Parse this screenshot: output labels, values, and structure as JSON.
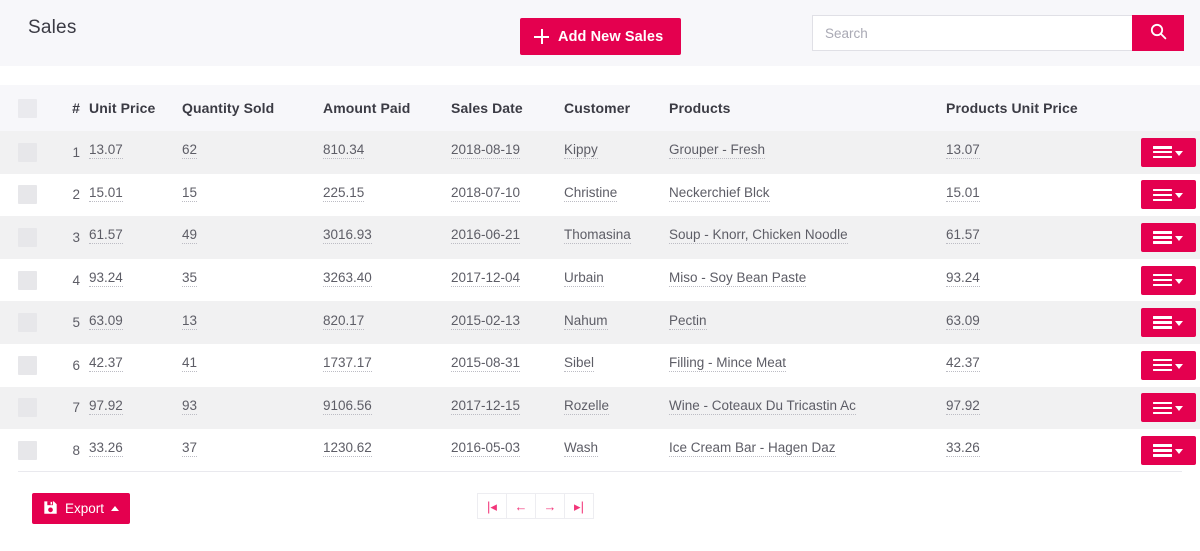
{
  "header": {
    "title": "Sales",
    "add_button_label": "Add New Sales",
    "add_button_icon": "plus-icon",
    "search_placeholder": "Search",
    "search_value": "",
    "search_icon": "search-icon"
  },
  "colors": {
    "accent": "#e4004f",
    "pager_accent": "#f2367a",
    "topbar_bg": "#f7f7fa",
    "row_odd_bg": "#f1f1f2",
    "row_even_bg": "#ffffff",
    "header_text": "#3b3b44",
    "cell_text": "#5d5d66"
  },
  "table": {
    "select_all_checkbox": "unchecked",
    "columns": [
      {
        "key": "select",
        "label": "",
        "name": "select-all-column"
      },
      {
        "key": "num",
        "label": "#",
        "name": "row-number-column"
      },
      {
        "key": "unit_price",
        "label": "Unit Price",
        "name": "unit-price-column"
      },
      {
        "key": "quantity",
        "label": "Quantity Sold",
        "name": "quantity-sold-column"
      },
      {
        "key": "amount",
        "label": "Amount Paid",
        "name": "amount-paid-column"
      },
      {
        "key": "date",
        "label": "Sales Date",
        "name": "sales-date-column"
      },
      {
        "key": "customer",
        "label": "Customer",
        "name": "customer-column"
      },
      {
        "key": "products",
        "label": "Products",
        "name": "products-column"
      },
      {
        "key": "prod_unit",
        "label": "Products Unit Price",
        "name": "products-unit-price-column"
      },
      {
        "key": "actions",
        "label": "",
        "name": "actions-column"
      }
    ],
    "rows": [
      {
        "num": "1",
        "unit_price": "13.07",
        "quantity": "62",
        "amount": "810.34",
        "date": "2018-08-19",
        "customer": "Kippy",
        "products": "Grouper - Fresh",
        "prod_unit": "13.07"
      },
      {
        "num": "2",
        "unit_price": "15.01",
        "quantity": "15",
        "amount": "225.15",
        "date": "2018-07-10",
        "customer": "Christine",
        "products": "Neckerchief Blck",
        "prod_unit": "15.01"
      },
      {
        "num": "3",
        "unit_price": "61.57",
        "quantity": "49",
        "amount": "3016.93",
        "date": "2016-06-21",
        "customer": "Thomasina",
        "products": "Soup - Knorr, Chicken Noodle",
        "prod_unit": "61.57"
      },
      {
        "num": "4",
        "unit_price": "93.24",
        "quantity": "35",
        "amount": "3263.40",
        "date": "2017-12-04",
        "customer": "Urbain",
        "products": "Miso - Soy Bean Paste",
        "prod_unit": "93.24"
      },
      {
        "num": "5",
        "unit_price": "63.09",
        "quantity": "13",
        "amount": "820.17",
        "date": "2015-02-13",
        "customer": "Nahum",
        "products": "Pectin",
        "prod_unit": "63.09"
      },
      {
        "num": "6",
        "unit_price": "42.37",
        "quantity": "41",
        "amount": "1737.17",
        "date": "2015-08-31",
        "customer": "Sibel",
        "products": "Filling - Mince Meat",
        "prod_unit": "42.37"
      },
      {
        "num": "7",
        "unit_price": "97.92",
        "quantity": "93",
        "amount": "9106.56",
        "date": "2017-12-15",
        "customer": "Rozelle",
        "products": "Wine - Coteaux Du Tricastin Ac",
        "prod_unit": "97.92"
      },
      {
        "num": "8",
        "unit_price": "33.26",
        "quantity": "37",
        "amount": "1230.62",
        "date": "2016-05-03",
        "customer": "Wash",
        "products": "Ice Cream Bar - Hagen Daz",
        "prod_unit": "33.26"
      }
    ],
    "row_action_icon": "hamburger-menu-icon",
    "row_action_caret": "caret-down-icon"
  },
  "footer": {
    "export_label": "Export",
    "export_icon": "save-floppy-icon",
    "export_caret": "caret-up-icon",
    "pagination": [
      {
        "key": "first",
        "glyph": "|◂",
        "name": "pagination-first-button"
      },
      {
        "key": "prev",
        "glyph": "←",
        "name": "pagination-prev-button"
      },
      {
        "key": "next",
        "glyph": "→",
        "name": "pagination-next-button"
      },
      {
        "key": "last",
        "glyph": "▸|",
        "name": "pagination-last-button"
      }
    ]
  }
}
